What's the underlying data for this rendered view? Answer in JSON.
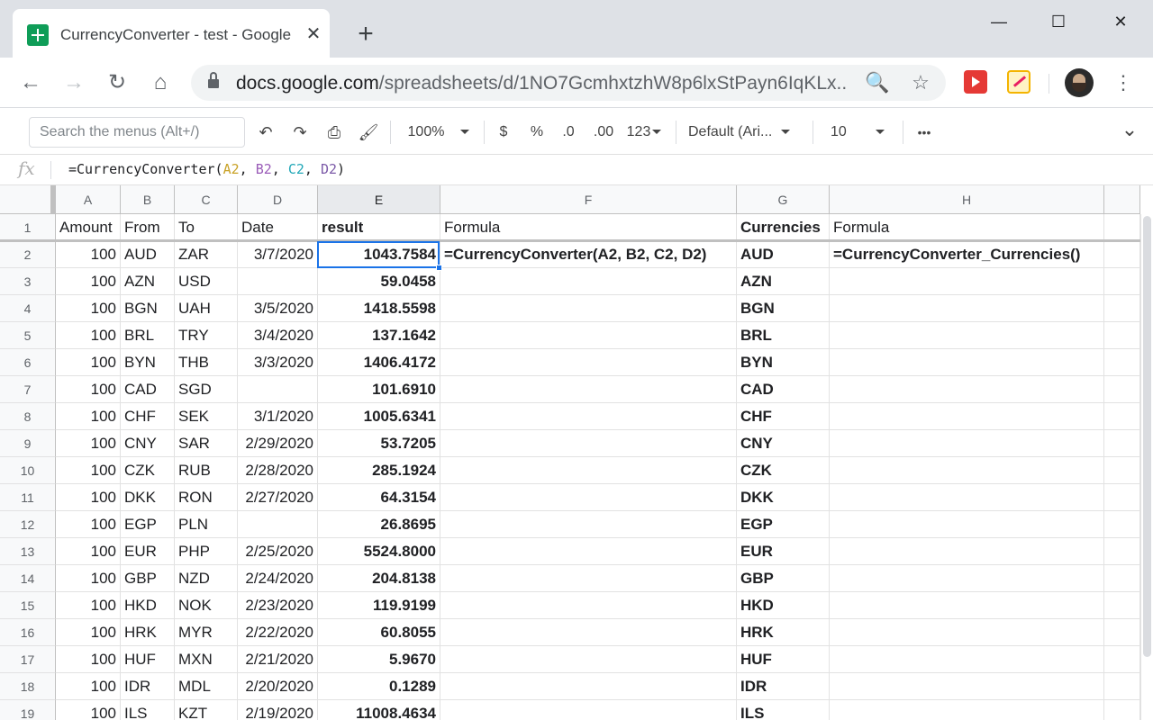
{
  "browser": {
    "tab_title": "CurrencyConverter - test - Google Sheets",
    "tab_close": "✕",
    "new_tab": "+",
    "window_controls": [
      "—",
      "☐",
      "✕"
    ],
    "url_host": "docs.google.com",
    "url_path": "/spreadsheets/d/1NO7GcmhxtzhW8p6lxStPayn6IqKLx...",
    "nav": {
      "back": "←",
      "forward": "→",
      "reload": "↻",
      "home": "⌂"
    },
    "omni_icons": {
      "zoom": "🔍",
      "bookmark": "☆"
    },
    "menu": "⋮"
  },
  "toolbar": {
    "search_placeholder": "Search the menus (Alt+/)",
    "undo": "↶",
    "redo": "↷",
    "print": "⎙",
    "paint_format": "🖌",
    "zoom": "100%",
    "currency": "$",
    "percent": "%",
    "decrease_decimals": ".0",
    "increase_decimals": ".00",
    "more_formats": "123",
    "font": "Default (Ari...",
    "font_size": "10",
    "more": "•••",
    "collapse": "⌄"
  },
  "formula_bar": {
    "fx": "fx",
    "prefix": "=CurrencyConverter(",
    "ref_a": "A2",
    "sep1": ", ",
    "ref_b": "B2",
    "sep2": ", ",
    "ref_c": "C2",
    "sep3": ", ",
    "ref_d": "D2",
    "suffix": ")"
  },
  "columns": [
    "A",
    "B",
    "C",
    "D",
    "E",
    "F",
    "G",
    "H"
  ],
  "selected_column": "E",
  "rows": [
    {
      "n": "1",
      "a": "Amount",
      "b": "From",
      "c": "To",
      "d": "Date",
      "e": "result",
      "f": "Formula",
      "g": "Currencies",
      "h": "Formula"
    },
    {
      "n": "2",
      "a": "100",
      "b": "AUD",
      "c": "ZAR",
      "d": "3/7/2020",
      "e": "1043.7584",
      "f": "=CurrencyConverter(A2, B2, C2, D2)",
      "g": "AUD",
      "h": "=CurrencyConverter_Currencies()"
    },
    {
      "n": "3",
      "a": "100",
      "b": "AZN",
      "c": "USD",
      "d": "",
      "e": "59.0458",
      "f": "",
      "g": "AZN",
      "h": ""
    },
    {
      "n": "4",
      "a": "100",
      "b": "BGN",
      "c": "UAH",
      "d": "3/5/2020",
      "e": "1418.5598",
      "f": "",
      "g": "BGN",
      "h": ""
    },
    {
      "n": "5",
      "a": "100",
      "b": "BRL",
      "c": "TRY",
      "d": "3/4/2020",
      "e": "137.1642",
      "f": "",
      "g": "BRL",
      "h": ""
    },
    {
      "n": "6",
      "a": "100",
      "b": "BYN",
      "c": "THB",
      "d": "3/3/2020",
      "e": "1406.4172",
      "f": "",
      "g": "BYN",
      "h": ""
    },
    {
      "n": "7",
      "a": "100",
      "b": "CAD",
      "c": "SGD",
      "d": "",
      "e": "101.6910",
      "f": "",
      "g": "CAD",
      "h": ""
    },
    {
      "n": "8",
      "a": "100",
      "b": "CHF",
      "c": "SEK",
      "d": "3/1/2020",
      "e": "1005.6341",
      "f": "",
      "g": "CHF",
      "h": ""
    },
    {
      "n": "9",
      "a": "100",
      "b": "CNY",
      "c": "SAR",
      "d": "2/29/2020",
      "e": "53.7205",
      "f": "",
      "g": "CNY",
      "h": ""
    },
    {
      "n": "10",
      "a": "100",
      "b": "CZK",
      "c": "RUB",
      "d": "2/28/2020",
      "e": "285.1924",
      "f": "",
      "g": "CZK",
      "h": ""
    },
    {
      "n": "11",
      "a": "100",
      "b": "DKK",
      "c": "RON",
      "d": "2/27/2020",
      "e": "64.3154",
      "f": "",
      "g": "DKK",
      "h": ""
    },
    {
      "n": "12",
      "a": "100",
      "b": "EGP",
      "c": "PLN",
      "d": "",
      "e": "26.8695",
      "f": "",
      "g": "EGP",
      "h": ""
    },
    {
      "n": "13",
      "a": "100",
      "b": "EUR",
      "c": "PHP",
      "d": "2/25/2020",
      "e": "5524.8000",
      "f": "",
      "g": "EUR",
      "h": ""
    },
    {
      "n": "14",
      "a": "100",
      "b": "GBP",
      "c": "NZD",
      "d": "2/24/2020",
      "e": "204.8138",
      "f": "",
      "g": "GBP",
      "h": ""
    },
    {
      "n": "15",
      "a": "100",
      "b": "HKD",
      "c": "NOK",
      "d": "2/23/2020",
      "e": "119.9199",
      "f": "",
      "g": "HKD",
      "h": ""
    },
    {
      "n": "16",
      "a": "100",
      "b": "HRK",
      "c": "MYR",
      "d": "2/22/2020",
      "e": "60.8055",
      "f": "",
      "g": "HRK",
      "h": ""
    },
    {
      "n": "17",
      "a": "100",
      "b": "HUF",
      "c": "MXN",
      "d": "2/21/2020",
      "e": "5.9670",
      "f": "",
      "g": "HUF",
      "h": ""
    },
    {
      "n": "18",
      "a": "100",
      "b": "IDR",
      "c": "MDL",
      "d": "2/20/2020",
      "e": "0.1289",
      "f": "",
      "g": "IDR",
      "h": ""
    },
    {
      "n": "19",
      "a": "100",
      "b": "ILS",
      "c": "KZT",
      "d": "2/19/2020",
      "e": "11008.4634",
      "f": "",
      "g": "ILS",
      "h": ""
    }
  ]
}
